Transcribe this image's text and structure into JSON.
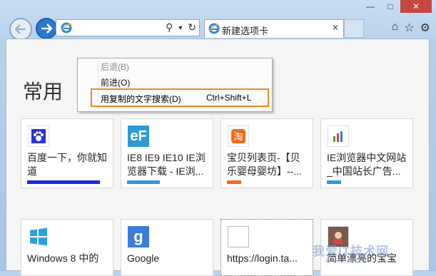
{
  "toolbar": {
    "address_value": "",
    "tab_title": "新建选项卡"
  },
  "page": {
    "heading": "常用"
  },
  "context_menu": {
    "back": "后退(B)",
    "forward": "前进(O)",
    "search_copied": "用复制的文字搜索(D)",
    "search_shortcut": "Ctrl+Shift+L"
  },
  "tiles": [
    {
      "title": "百度一下，你就知道",
      "icon": "baidu-paw-icon",
      "bar_color": "#1a2adf",
      "bar_fill": 1.0
    },
    {
      "title": "IE8 IE9 IE10 IE浏览器下载 - IE浏...",
      "icon": "ie-logo-icon",
      "bar_color": "#2f9ad6",
      "bar_fill": 0.45
    },
    {
      "title": "宝贝列表页-【贝乐婴母婴坊】--...",
      "icon": "taobao-icon",
      "bar_color": "#f26a1b",
      "bar_fill": 0.2
    },
    {
      "title": "IE浏览器中文网站_中国站长广告...",
      "icon": "chart-icon",
      "bar_color": "#2f9ad6",
      "bar_fill": 0.2
    },
    {
      "title": "Windows 8 中的",
      "icon": "windows-logo-icon",
      "bar_color": "",
      "bar_fill": 0
    },
    {
      "title": "Google",
      "icon": "google-g-icon",
      "bar_color": "",
      "bar_fill": 0
    },
    {
      "title": "https://login.ta...",
      "icon": "blank-page-icon",
      "bar_color": "",
      "bar_fill": 0
    },
    {
      "title": "简单漂亮的宝宝",
      "icon": "photo-icon",
      "bar_color": "",
      "bar_fill": 0
    }
  ],
  "watermark": {
    "main": "我爱IT技术网",
    "sub": "www.52ij.com"
  }
}
